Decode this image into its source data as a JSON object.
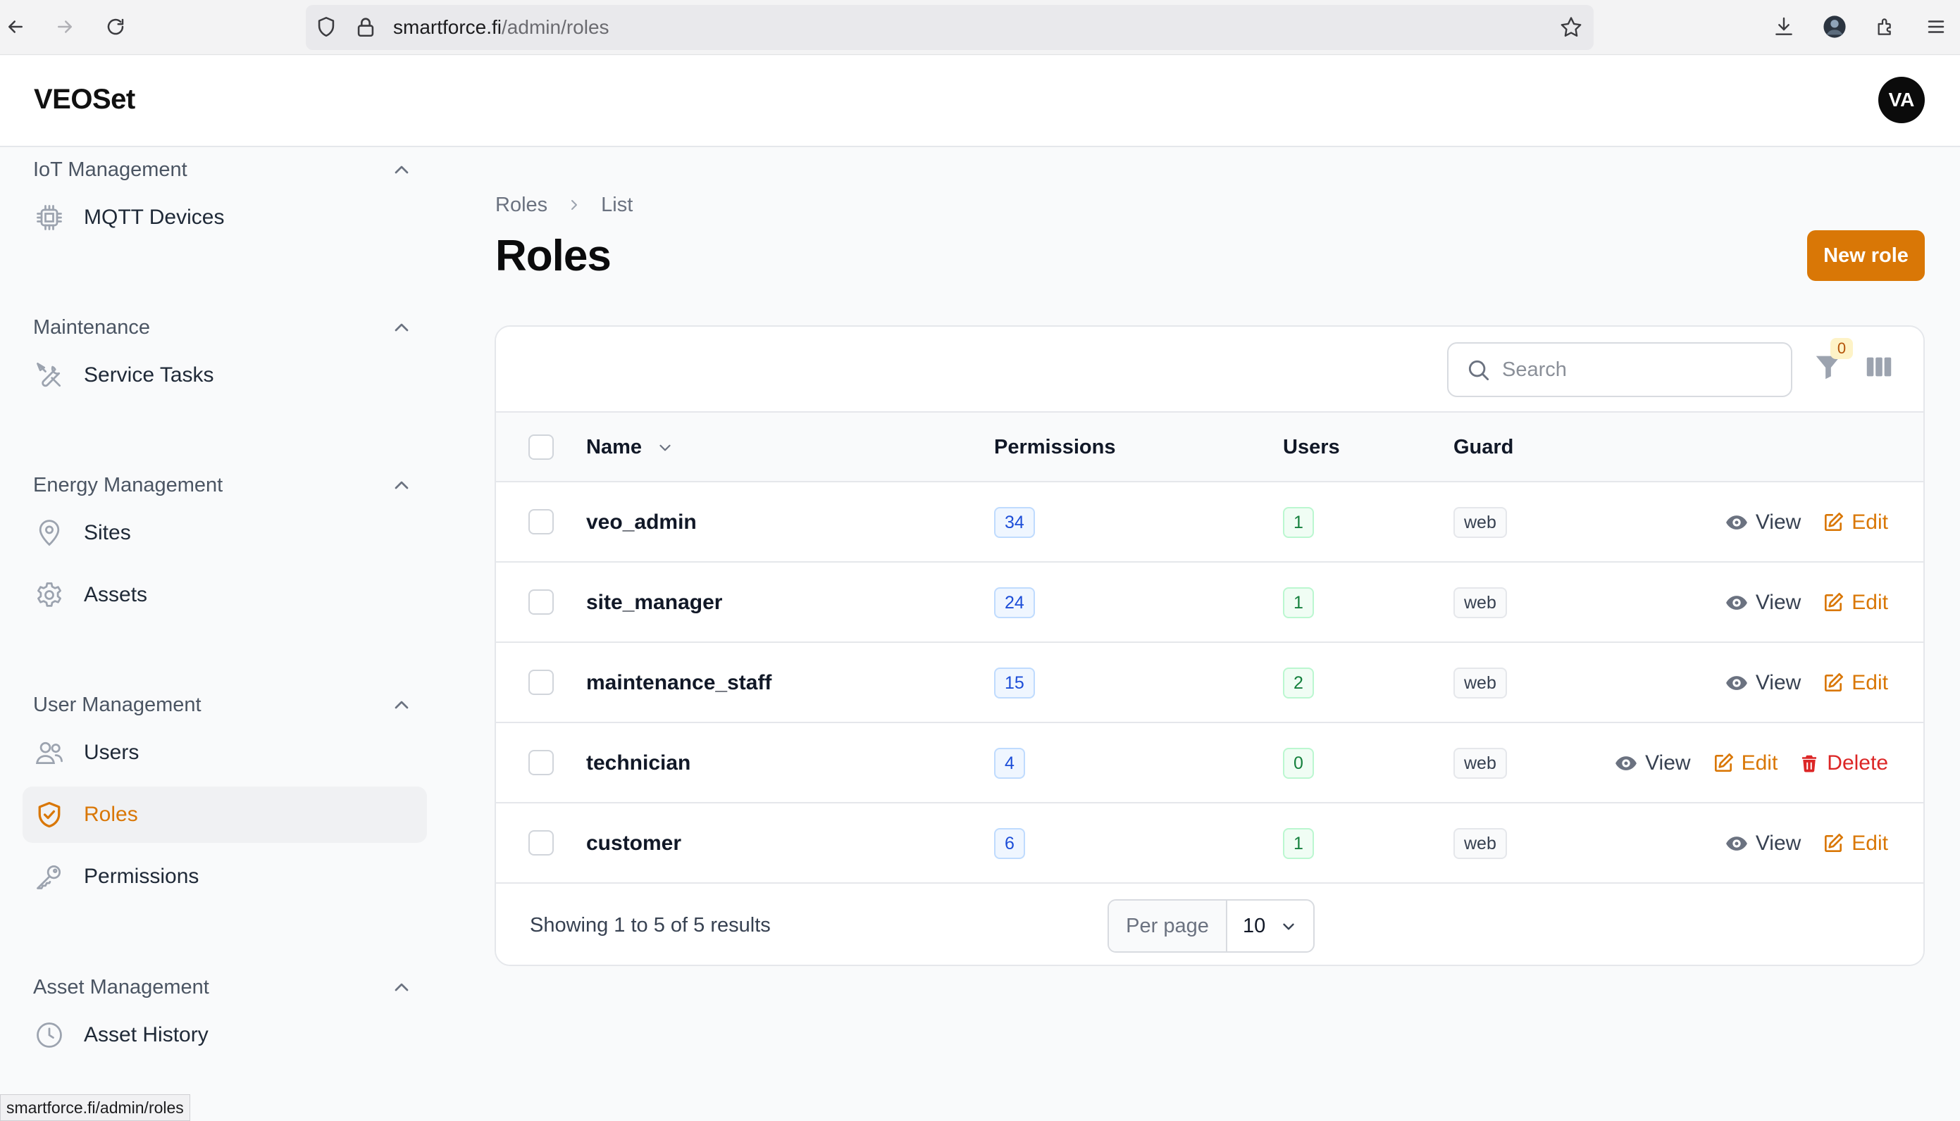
{
  "browser": {
    "url_host": "smartforce.fi",
    "url_path": "/admin/roles",
    "status_url": "smartforce.fi/admin/roles"
  },
  "app": {
    "brand": "VEOSet",
    "avatar_initials": "VA"
  },
  "sidebar": {
    "groups": [
      {
        "title": "IoT Management",
        "items": [
          {
            "label": "MQTT Devices",
            "icon": "cpu-chip-icon"
          }
        ]
      },
      {
        "title": "Maintenance",
        "items": [
          {
            "label": "Service Tasks",
            "icon": "wrench-screwdriver-icon"
          }
        ]
      },
      {
        "title": "Energy Management",
        "items": [
          {
            "label": "Sites",
            "icon": "map-pin-icon"
          },
          {
            "label": "Assets",
            "icon": "cog-icon"
          }
        ]
      },
      {
        "title": "User Management",
        "items": [
          {
            "label": "Users",
            "icon": "users-icon"
          },
          {
            "label": "Roles",
            "icon": "shield-check-icon",
            "active": true
          },
          {
            "label": "Permissions",
            "icon": "key-icon"
          }
        ]
      },
      {
        "title": "Asset Management",
        "items": [
          {
            "label": "Asset History",
            "icon": "clock-icon"
          }
        ]
      }
    ]
  },
  "page": {
    "breadcrumb": [
      "Roles",
      "List"
    ],
    "title": "Roles",
    "new_button": "New role"
  },
  "table": {
    "search_placeholder": "Search",
    "filter_count": "0",
    "columns": {
      "name": "Name",
      "permissions": "Permissions",
      "users": "Users",
      "guard": "Guard"
    },
    "rows": [
      {
        "name": "veo_admin",
        "permissions": "34",
        "users": "1",
        "guard": "web",
        "actions": [
          "View",
          "Edit"
        ]
      },
      {
        "name": "site_manager",
        "permissions": "24",
        "users": "1",
        "guard": "web",
        "actions": [
          "View",
          "Edit"
        ]
      },
      {
        "name": "maintenance_staff",
        "permissions": "15",
        "users": "2",
        "guard": "web",
        "actions": [
          "View",
          "Edit"
        ]
      },
      {
        "name": "technician",
        "permissions": "4",
        "users": "0",
        "guard": "web",
        "actions": [
          "View",
          "Edit",
          "Delete"
        ]
      },
      {
        "name": "customer",
        "permissions": "6",
        "users": "1",
        "guard": "web",
        "actions": [
          "View",
          "Edit"
        ]
      }
    ],
    "footer": {
      "showing": "Showing 1 to 5 of 5 results",
      "per_page_label": "Per page",
      "per_page_value": "10"
    }
  },
  "colors": {
    "accent": "#d97706",
    "danger": "#dc2626"
  }
}
